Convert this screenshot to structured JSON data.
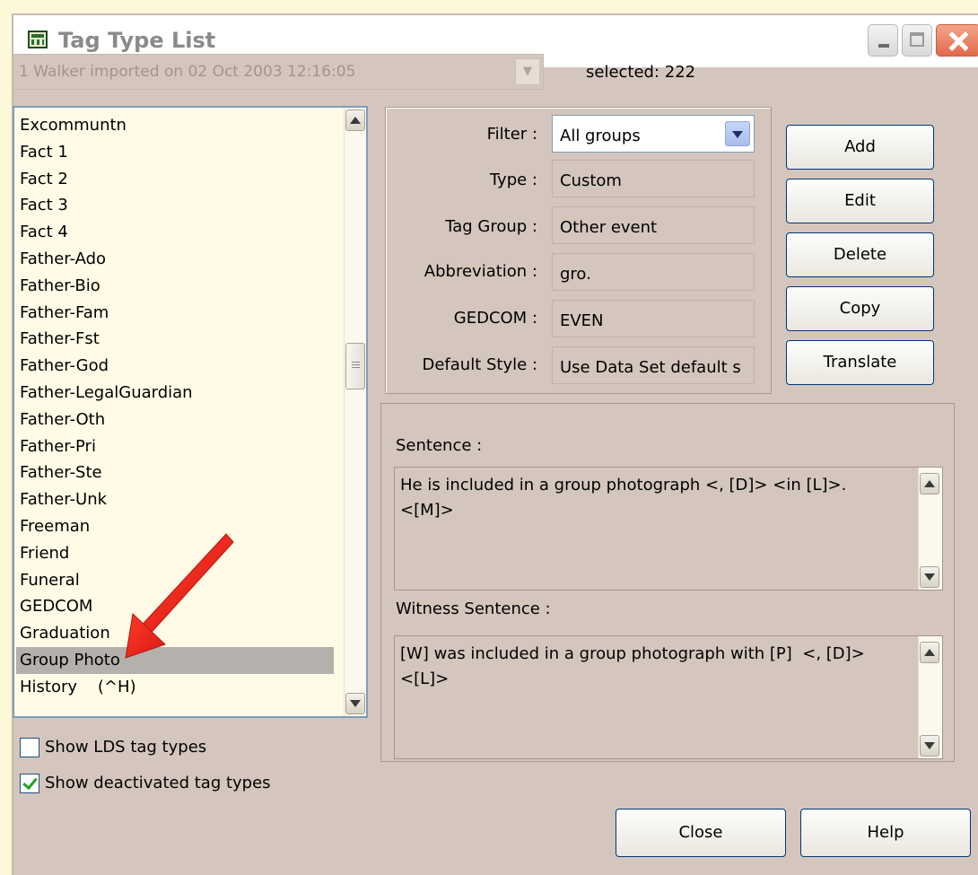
{
  "window": {
    "title": "Tag Type List"
  },
  "dataset": {
    "value": "1 Walker imported on 02 Oct 2003 12:16:05",
    "selected_text": "selected: 222"
  },
  "tag_list": {
    "items": [
      "Excommuntn",
      "Fact 1",
      "Fact 2",
      "Fact 3",
      "Fact 4",
      "Father-Ado",
      "Father-Bio",
      "Father-Fam",
      "Father-Fst",
      "Father-God",
      "Father-LegalGuardian",
      "Father-Oth",
      "Father-Pri",
      "Father-Ste",
      "Father-Unk",
      "Freeman",
      "Friend",
      "Funeral",
      "GEDCOM",
      "Graduation",
      "Group Photo",
      "History    (^H)"
    ],
    "selected": "Group Photo"
  },
  "options": {
    "show_lds_label": "Show LDS tag types",
    "show_lds_checked": false,
    "show_deactivated_label": "Show deactivated tag types",
    "show_deactivated_checked": true
  },
  "properties": {
    "filter_label": "Filter :",
    "filter_value": "All groups",
    "type_label": "Type :",
    "type_value": "Custom",
    "tag_group_label": "Tag Group :",
    "tag_group_value": "Other event",
    "abbreviation_label": "Abbreviation :",
    "abbreviation_value": "gro.",
    "gedcom_label": "GEDCOM :",
    "gedcom_value": "EVEN",
    "default_style_label": "Default Style :",
    "default_style_value": "Use Data Set default s"
  },
  "actions": {
    "add": "Add",
    "edit": "Edit",
    "delete": "Delete",
    "copy": "Copy",
    "translate": "Translate"
  },
  "sentences": {
    "sentence_label": "Sentence :",
    "sentence_value": "He is included in a group photograph <, [D]> <in [L]>.\n<[M]>",
    "witness_label": "Witness Sentence :",
    "witness_value": "[W] was included in a group photograph with [P]  <, [D]>\n<[L]>"
  },
  "footer": {
    "close": "Close",
    "help": "Help"
  },
  "colors": {
    "window_bg": "#d4c6bd",
    "list_bg": "#fffbe6",
    "selection": "#b4b0ab",
    "annotation_arrow": "#e8231a"
  }
}
